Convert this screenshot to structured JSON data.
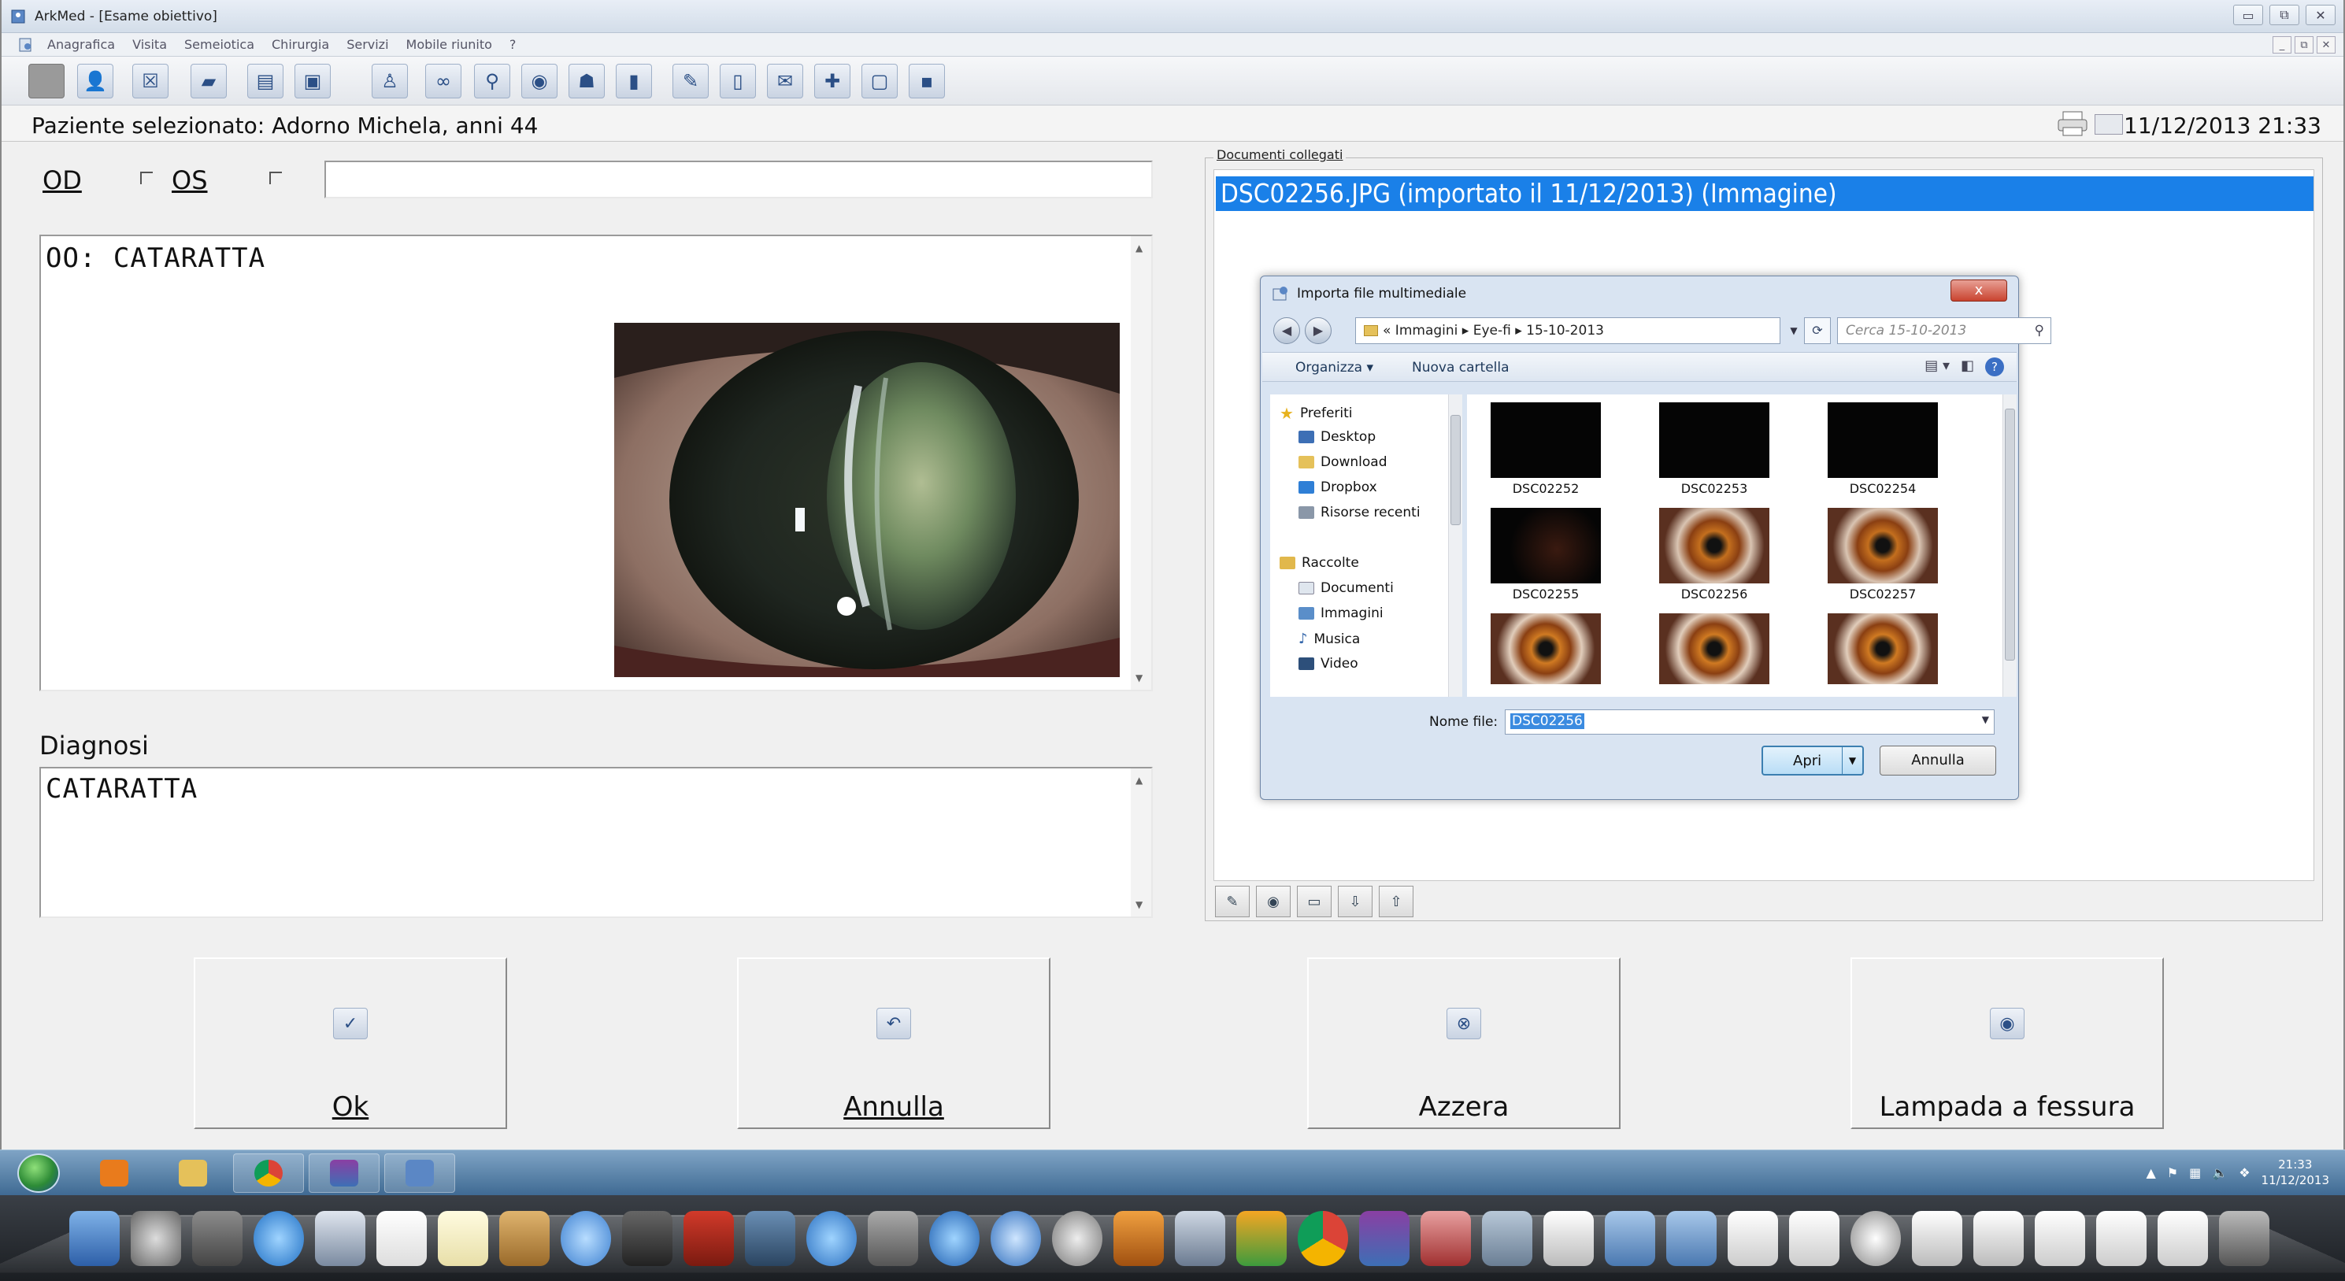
{
  "window": {
    "title": "ArkMed - [Esame obiettivo]",
    "controls": [
      "▭",
      "⧉",
      "✕"
    ]
  },
  "menu": {
    "items": [
      "Anagrafica",
      "Visita",
      "Semeiotica",
      "Chirurgia",
      "Servizi",
      "Mobile riunito",
      "?"
    ],
    "mdi_controls": [
      "_",
      "⧉",
      "✕"
    ]
  },
  "toolbar": {
    "icons": [
      "blank-icon",
      "patient-icon",
      "close-record-icon",
      "folder-icon",
      "list-icon",
      "card-icon",
      "person-icon",
      "binoculars-icon",
      "magnifier-icon",
      "eye-icon",
      "group-icon",
      "clipboard-icon",
      "pencil-icon",
      "book-icon",
      "mail-icon",
      "medical-kit-icon",
      "document-icon",
      "save-icon"
    ]
  },
  "patient_bar": {
    "patient": "Paziente selezionato: Adorno Michela,  anni 44",
    "date": "11/12/2013",
    "time": "21:33"
  },
  "form": {
    "od_label": "OD",
    "os_label": "OS",
    "top_input_value": "",
    "notes_text": "OO: CATARATTA",
    "diagnosis_label": "Diagnosi",
    "diagnosis_text": "CATARATTA"
  },
  "documents": {
    "group_label": "Documenti collegati",
    "selected_item": "DSC02256.JPG (importato il 11/12/2013)  (Immagine)"
  },
  "dialog": {
    "title": "Importa file multimediale",
    "close": "x",
    "breadcrumb": "«  Immagini  ▸  Eye-fi  ▸  15-10-2013",
    "search_placeholder": "Cerca 15-10-2013",
    "organize": "Organizza ▾",
    "new_folder": "Nuova cartella",
    "nav": {
      "favorites": "Preferiti",
      "desktop": "Desktop",
      "download": "Download",
      "dropbox": "Dropbox",
      "recent": "Risorse recenti",
      "libraries": "Raccolte",
      "documents": "Documenti",
      "images": "Immagini",
      "music": "Musica",
      "video": "Video"
    },
    "files": [
      "DSC02252",
      "DSC02253",
      "DSC02254",
      "DSC02255",
      "DSC02256",
      "DSC02257"
    ],
    "filename_label": "Nome file:",
    "filename_value": "DSC02256",
    "open_button": "Apri",
    "cancel_button": "Annulla"
  },
  "actions": {
    "ok": "Ok",
    "cancel": "Annulla",
    "reset": "Azzera",
    "slit_lamp": "Lampada a fessura"
  },
  "taskbar": {
    "clock_time": "21:33",
    "clock_date": "11/12/2013"
  },
  "colors": {
    "selection_blue": "#1a80e8",
    "window_bg": "#f0f0f0"
  }
}
